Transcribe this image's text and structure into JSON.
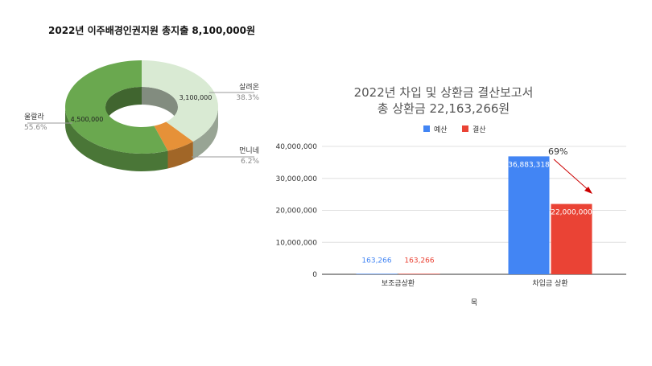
{
  "chart_data": [
    {
      "type": "pie",
      "title": "2022년 이주배경인권지원 총지출 8,100,000원",
      "slices": [
        {
          "name": "살려온",
          "value": 3100000,
          "value_label": "3,100,000",
          "percent_label": "38.3%",
          "color": "#d9ead3"
        },
        {
          "name": "먼니네",
          "value": 500000,
          "value_label": "",
          "percent_label": "6.2%",
          "color": "#e69138"
        },
        {
          "name": "울랄라",
          "value": 4500000,
          "value_label": "4,500,000",
          "percent_label": "55.6%",
          "color": "#6aa84f"
        }
      ]
    },
    {
      "type": "bar",
      "title": "2022년 차입 및 상환금 결산보고서",
      "subtitle": "총 상환금 22,163,266원",
      "xlabel": "목",
      "ylabel": "",
      "ylim": [
        0,
        40000000
      ],
      "yticks": [
        "0",
        "10,000,000",
        "20,000,000",
        "30,000,000",
        "40,000,000"
      ],
      "categories": [
        "보조금상환",
        "차입금 상환"
      ],
      "series": [
        {
          "name": "예산",
          "color": "#4285f4",
          "values": [
            163266,
            36883318
          ],
          "labels": [
            "163,266",
            "36,883,318"
          ]
        },
        {
          "name": "결산",
          "color": "#ea4335",
          "values": [
            163266,
            22000000
          ],
          "labels": [
            "163,266",
            "22,000,000"
          ]
        }
      ],
      "annotation": "69%",
      "annotation_color": "#cc0000",
      "grid": true,
      "legend": "top"
    }
  ]
}
